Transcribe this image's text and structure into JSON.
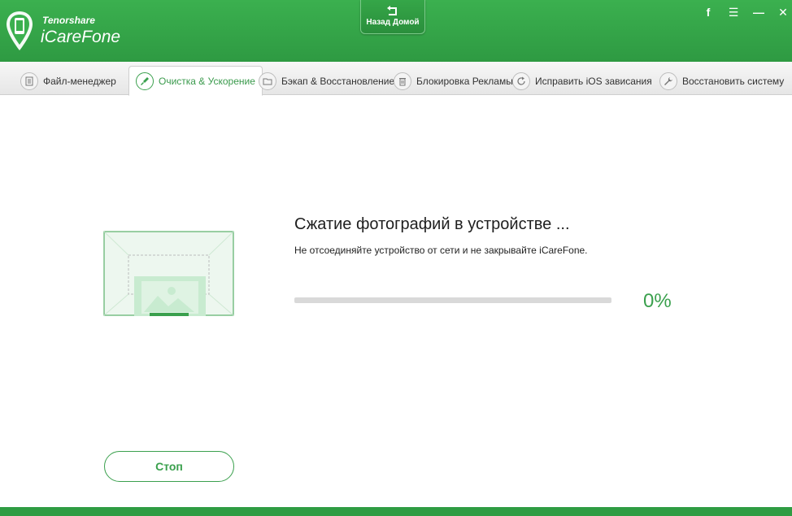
{
  "header": {
    "brand_small": "Tenorshare",
    "brand_name": "iCareFone",
    "back_home_label": "Назад Домой",
    "colors": {
      "primary": "#2e9a42",
      "accent": "#3aa04d"
    },
    "window_controls": [
      {
        "name": "facebook-icon",
        "glyph": "f"
      },
      {
        "name": "menu-icon",
        "glyph": "☰"
      },
      {
        "name": "minimize-icon",
        "glyph": "—"
      },
      {
        "name": "close-icon",
        "glyph": "✕"
      }
    ]
  },
  "tabs": [
    {
      "label": "Файл-менеджер",
      "icon": "file-icon",
      "active": false
    },
    {
      "label": "Очистка & Ускорение",
      "icon": "brush-icon",
      "active": true
    },
    {
      "label": "Бэкап & Восстановление",
      "icon": "folder-icon",
      "active": false
    },
    {
      "label": "Блокировка Рекламы",
      "icon": "trash-icon",
      "active": false
    },
    {
      "label": "Исправить iOS зависания",
      "icon": "refresh-icon",
      "active": false
    },
    {
      "label": "Восстановить систему",
      "icon": "wrench-icon",
      "active": false
    }
  ],
  "main": {
    "title": "Сжатие фотографий в устройстве ...",
    "subtitle": "Не отсоединяйте устройство от сети и не закрывайте iCareFone.",
    "progress_percent": 0,
    "percent_label": "0%",
    "stop_label": "Стоп"
  }
}
